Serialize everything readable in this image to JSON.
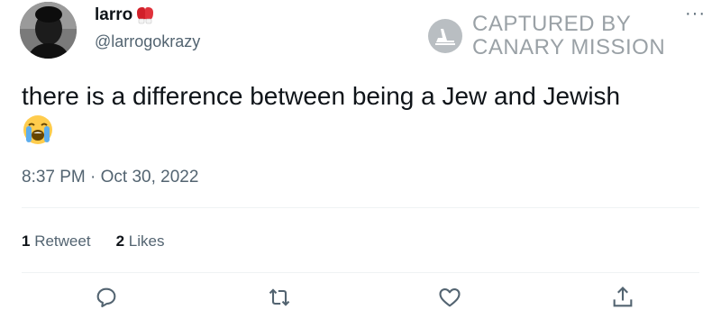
{
  "tweet": {
    "display_name": "larro",
    "handle": "@larrogokrazy",
    "text": "there is a difference between being a Jew and Jewish",
    "emoji": "loudly-crying-face",
    "timestamp": "8:37 PM · Oct 30, 2022",
    "retweets_count": "1",
    "retweets_label": "Retweet",
    "likes_count": "2",
    "likes_label": "Likes",
    "more_label": "···"
  },
  "watermark": {
    "line1": "CAPTURED BY",
    "line2": "CANARY MISSION"
  },
  "actions": [
    {
      "name": "reply",
      "icon": "comment-icon"
    },
    {
      "name": "retweet",
      "icon": "retweet-icon"
    },
    {
      "name": "like",
      "icon": "heart-icon"
    },
    {
      "name": "share",
      "icon": "share-icon"
    }
  ],
  "colors": {
    "text": "#0f1419",
    "secondary": "#536471",
    "divider": "#eff3f4",
    "watermark": "#9aa1a6"
  }
}
